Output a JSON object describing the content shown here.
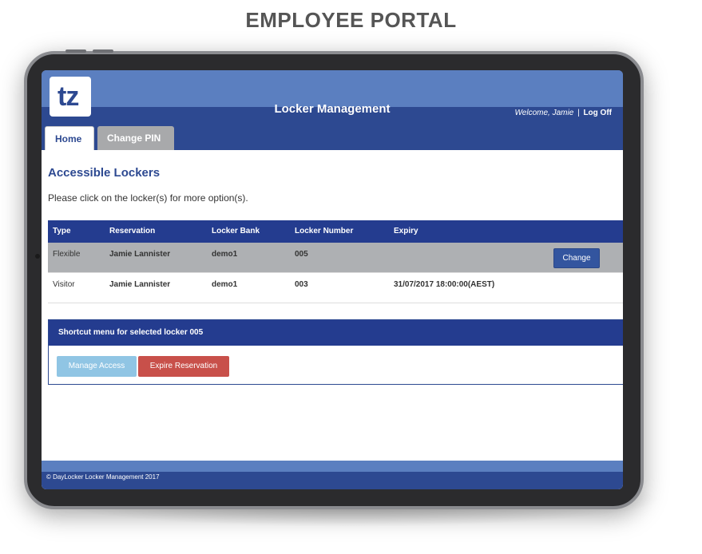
{
  "page": {
    "title": "EMPLOYEE PORTAL"
  },
  "app": {
    "logo_text": "tz",
    "title": "Locker Management",
    "welcome": "Welcome, Jamie",
    "separator": "|",
    "logoff": "Log Off"
  },
  "tabs": {
    "home": "Home",
    "change_pin": "Change PIN"
  },
  "content": {
    "heading": "Accessible Lockers",
    "instructions": "Please click on the locker(s) for more option(s)."
  },
  "table": {
    "headers": [
      "Type",
      "Reservation",
      "Locker Bank",
      "Locker Number",
      "Expiry"
    ],
    "rows": [
      {
        "type": "Flexible",
        "reservation": "Jamie Lannister",
        "bank": "demo1",
        "number": "005",
        "expiry": "",
        "action": "Change"
      },
      {
        "type": "Visitor",
        "reservation": "Jamie Lannister",
        "bank": "demo1",
        "number": "003",
        "expiry": "31/07/2017 18:00:00(AEST)"
      }
    ]
  },
  "shortcut": {
    "title": "Shortcut menu for selected locker 005",
    "manage": "Manage Access",
    "expire": "Expire Reservation"
  },
  "footer": {
    "text": "© DayLocker Locker Management 2017"
  },
  "colors": {
    "brand": "#2d4991",
    "brand_light": "#5b7fc0",
    "selected_row": "#aeb0b3",
    "manage_btn": "#90c5e4",
    "expire_btn": "#c8504a"
  }
}
